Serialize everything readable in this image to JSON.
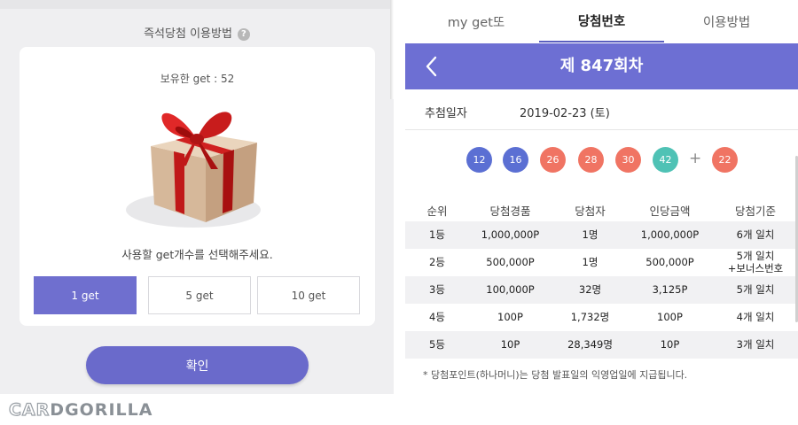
{
  "left": {
    "howto_title": "즉석당첨 이용방법",
    "help_icon_glyph": "?",
    "owned_text": "보유한 get : 52",
    "use_text": "사용할 get개수를 선택해주세요.",
    "options": [
      {
        "label": "1 get",
        "active": true
      },
      {
        "label": "5 get",
        "active": false
      },
      {
        "label": "10 get",
        "active": false
      }
    ],
    "confirm_label": "확인"
  },
  "logo": {
    "part1": "CAR",
    "part2": "D",
    "part3": "GORILLA"
  },
  "right": {
    "tabs": [
      {
        "label": "my get또",
        "active": false
      },
      {
        "label": "당첨번호",
        "active": true
      },
      {
        "label": "이용방법",
        "active": false
      }
    ],
    "round_title": "제 847회차",
    "date_label": "추첨일자",
    "date_value": "2019-02-23 (토)",
    "balls": [
      {
        "num": "12",
        "color": "#5b6fd3"
      },
      {
        "num": "16",
        "color": "#5b6fd3"
      },
      {
        "num": "26",
        "color": "#f07463"
      },
      {
        "num": "28",
        "color": "#f07463"
      },
      {
        "num": "30",
        "color": "#f07463"
      },
      {
        "num": "42",
        "color": "#4fc2b5"
      }
    ],
    "plus": "+",
    "bonus": {
      "num": "22",
      "color": "#f07463"
    },
    "table_headers": [
      "순위",
      "당첨경품",
      "당첨자",
      "인당금액",
      "당첨기준"
    ],
    "rows": [
      [
        "1등",
        "1,000,000P",
        "1명",
        "1,000,000P",
        "6개 일치"
      ],
      [
        "2등",
        "500,000P",
        "1명",
        "500,000P",
        "5개 일치\n+보너스번호"
      ],
      [
        "3등",
        "100,000P",
        "32명",
        "3,125P",
        "5개 일치"
      ],
      [
        "4등",
        "100P",
        "1,732명",
        "100P",
        "4개 일치"
      ],
      [
        "5등",
        "10P",
        "28,349명",
        "10P",
        "3개 일치"
      ]
    ],
    "note": "* 당첨포인트(하나머니)는 당첨 발표일의 익영업일에 지급됩니다."
  },
  "colors": {
    "accent": "#6d6fd3",
    "button": "#6a6acb",
    "tab_underline": "#5a5fbf",
    "row_shade": "#f1f1f3"
  },
  "icons": {
    "back": "chevron-left-icon",
    "help": "question-icon",
    "gift": "gift-box-icon"
  }
}
